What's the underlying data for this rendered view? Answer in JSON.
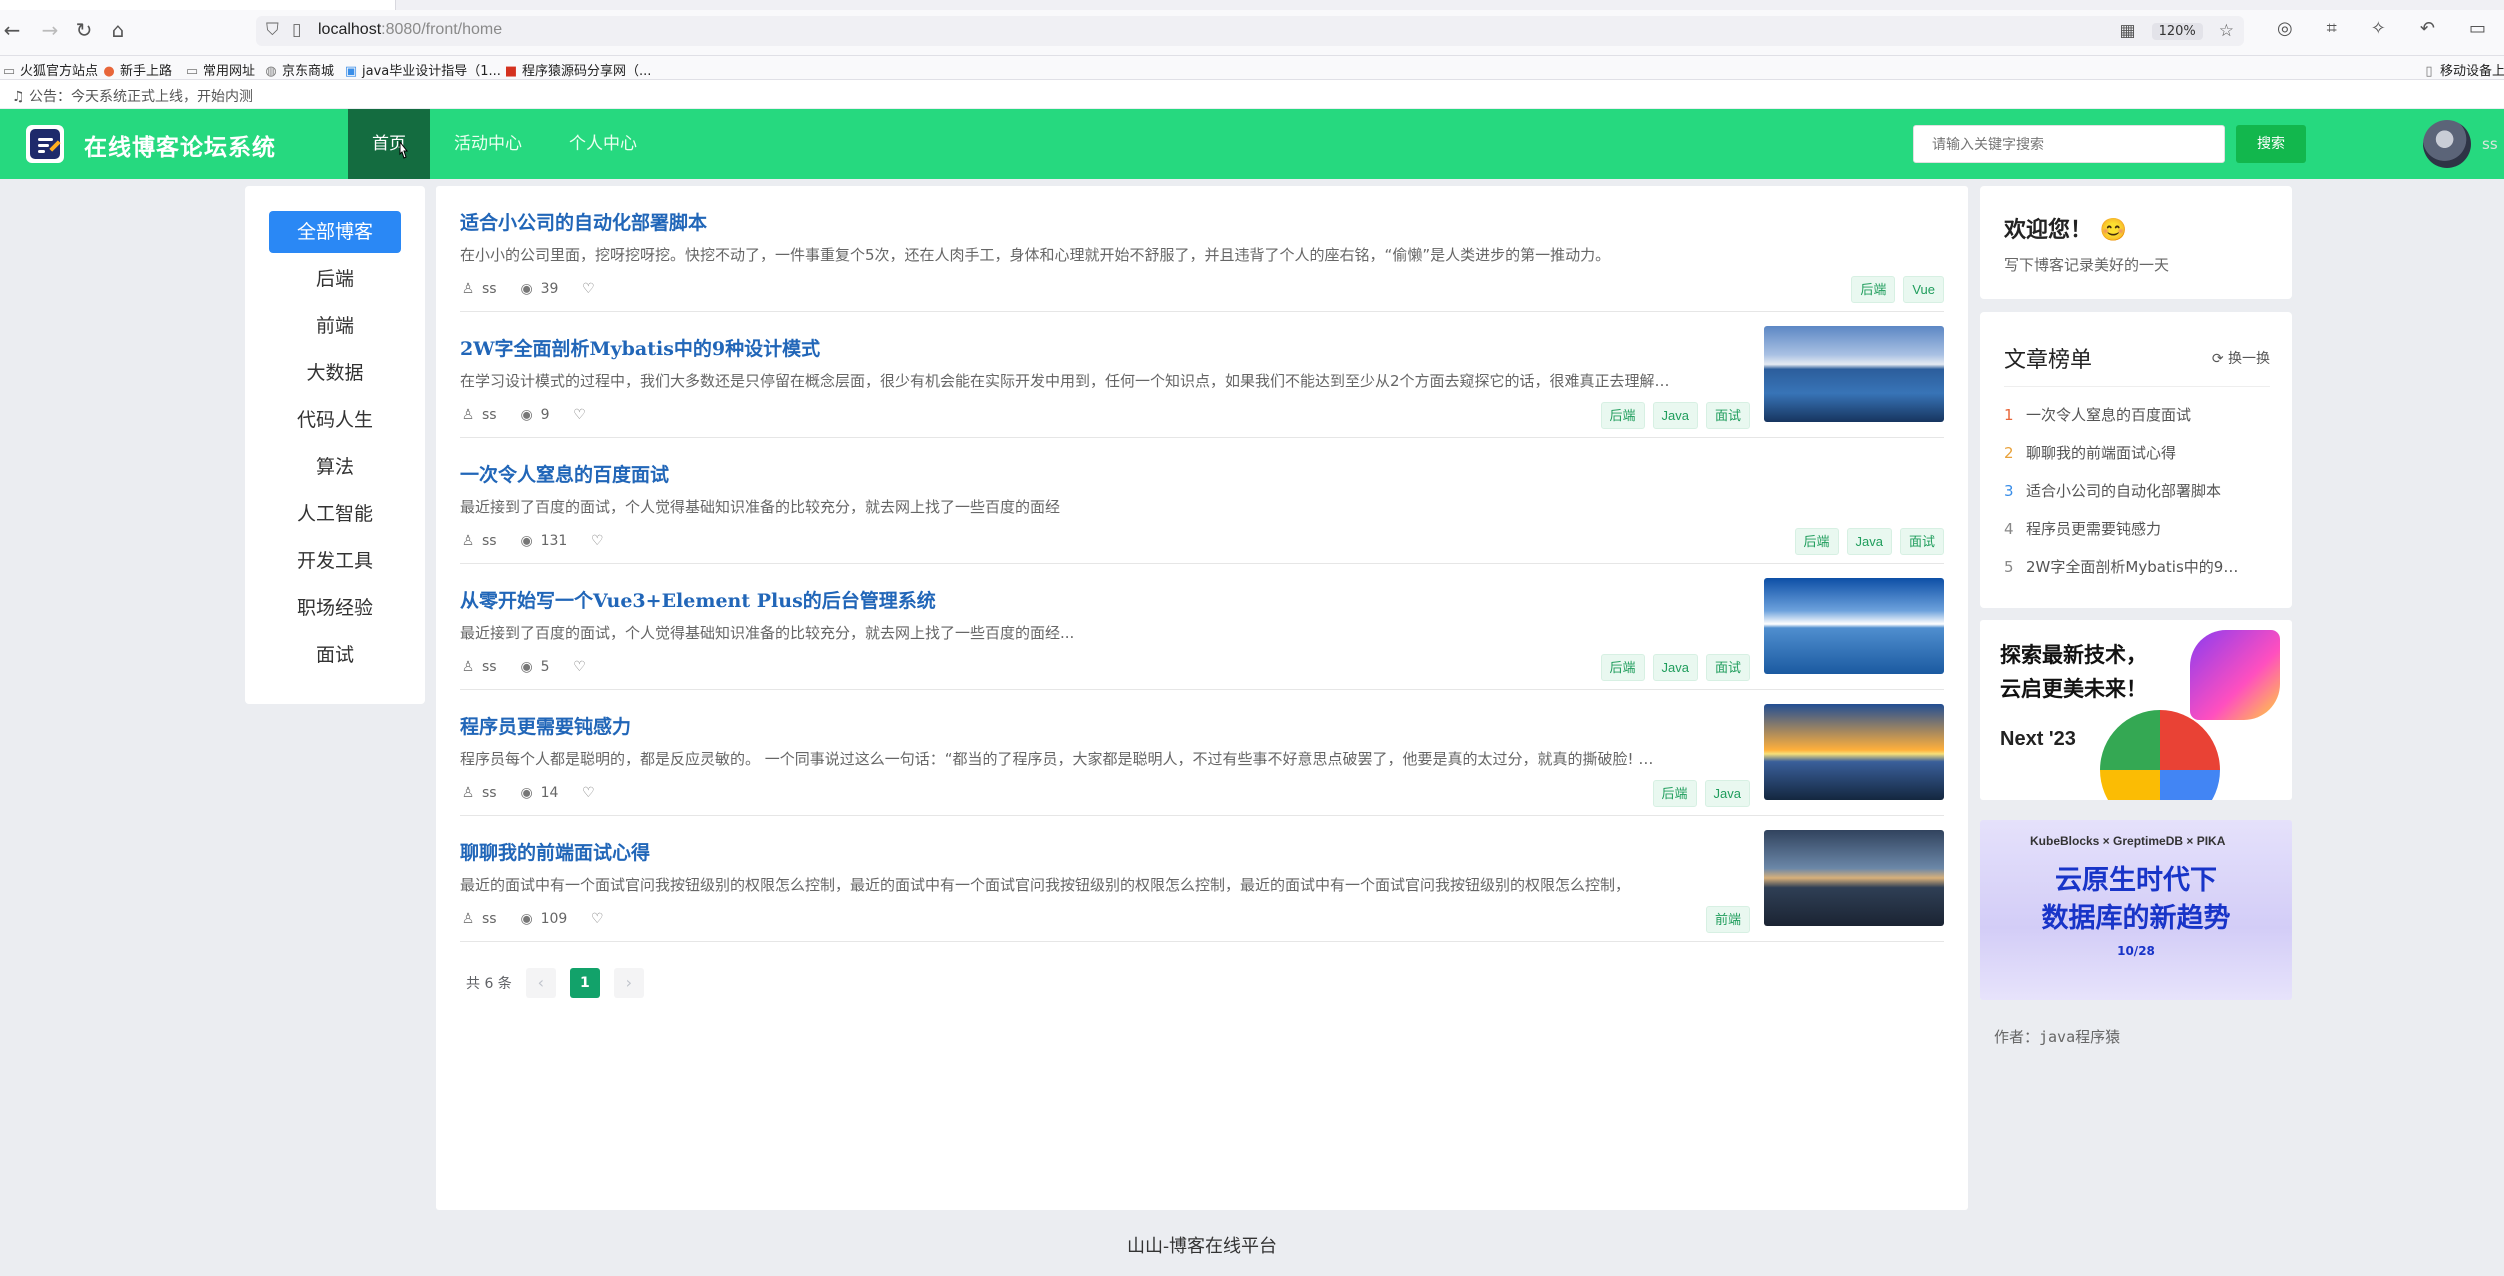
{
  "browser": {
    "url_host": "localhost",
    "url_path": ":8080/front/home",
    "zoom": "120%",
    "bookmarks": [
      "火狐官方站点",
      "新手上路",
      "常用网址",
      "京东商城",
      "java毕业设计指导（1...",
      "程序猿源码分享网（...",
      "移动设备上的"
    ]
  },
  "announcement": "公告：今天系统正式上线，开始内测",
  "header": {
    "site_title": "在线博客论坛系统",
    "nav": [
      "首页",
      "活动中心",
      "个人中心"
    ],
    "search_placeholder": "请输入关键字搜索",
    "search_button": "搜索",
    "username": "ss"
  },
  "categories": [
    "全部博客",
    "后端",
    "前端",
    "大数据",
    "代码人生",
    "算法",
    "人工智能",
    "开发工具",
    "职场经验",
    "面试"
  ],
  "articles": [
    {
      "title": "适合小公司的自动化部署脚本",
      "desc": "在小小的公司里面，挖呀挖呀挖。快挖不动了，一件事重复个5次，还在人肉手工，身体和心理就开始不舒服了，并且违背了个人的座右铭，“偷懒”是人类进步的第一推动力。",
      "author": "ss",
      "views": "39",
      "tags": [
        "后端",
        "Vue"
      ],
      "has_image": false
    },
    {
      "title": "2W字全面剖析Mybatis中的9种设计模式",
      "desc": "在学习设计模式的过程中，我们大多数还是只停留在概念层面，很少有机会能在实际开发中用到，任何一个知识点，如果我们不能达到至少从2个方面去窥探它的话，很难真正去理解…",
      "author": "ss",
      "views": "9",
      "tags": [
        "后端",
        "Java",
        "面试"
      ],
      "has_image": true
    },
    {
      "title": "一次令人窒息的百度面试",
      "desc": "最近接到了百度的面试，个人觉得基础知识准备的比较充分，就去网上找了一些百度的面经",
      "author": "ss",
      "views": "131",
      "tags": [
        "后端",
        "Java",
        "面试"
      ],
      "has_image": false
    },
    {
      "title": "从零开始写一个Vue3+Element Plus的后台管理系统",
      "desc": "最近接到了百度的面试，个人觉得基础知识准备的比较充分，就去网上找了一些百度的面经...",
      "author": "ss",
      "views": "5",
      "tags": [
        "后端",
        "Java",
        "面试"
      ],
      "has_image": true
    },
    {
      "title": "程序员更需要钝感力",
      "desc": "程序员每个人都是聪明的，都是反应灵敏的。 一个同事说过这么一句话：“都当的了程序员，大家都是聪明人，不过有些事不好意思点破罢了，他要是真的太过分，就真的撕破脸! …",
      "author": "ss",
      "views": "14",
      "tags": [
        "后端",
        "Java"
      ],
      "has_image": true
    },
    {
      "title": "聊聊我的前端面试心得",
      "desc": "最近的面试中有一个面试官问我按钮级别的权限怎么控制，最近的面试中有一个面试官问我按钮级别的权限怎么控制，最近的面试中有一个面试官问我按钮级别的权限怎么控制，",
      "author": "ss",
      "views": "109",
      "tags": [
        "前端"
      ],
      "has_image": true
    }
  ],
  "pagination": {
    "total": "共 6 条",
    "current": "1"
  },
  "welcome": {
    "title": "欢迎您！ 😊",
    "subtitle": "写下博客记录美好的一天"
  },
  "ranking": {
    "title": "文章榜单",
    "refresh": "换一换",
    "items": [
      {
        "num": "1",
        "text": "一次令人窒息的百度面试",
        "color": "#e8663a"
      },
      {
        "num": "2",
        "text": "聊聊我的前端面试心得",
        "color": "#e8a13a"
      },
      {
        "num": "3",
        "text": "适合小公司的自动化部署脚本",
        "color": "#3a8ee8"
      },
      {
        "num": "4",
        "text": "程序员更需要钝感力",
        "color": "#888888"
      },
      {
        "num": "5",
        "text": "2W字全面剖析Mybatis中的9…",
        "color": "#888888"
      }
    ]
  },
  "ads": {
    "ad1_headline_1": "探索最新技术，",
    "ad1_headline_2": "云启更美未来！",
    "ad1_next": "Next '23",
    "ad2_sponsors": "KubeBlocks × GreptimeDB × PIKA",
    "ad2_line1": "云原生时代下",
    "ad2_line2": "数据库的新趋势",
    "ad2_date": "10/28"
  },
  "author_note": "作者：java程序猿",
  "footer": "山山-博客在线平台",
  "colors": {
    "header": "#26d97f",
    "active_nav": "#146c40",
    "active_category": "#2a88f5",
    "title_link": "#2166b8",
    "search_button": "#12b74d"
  }
}
